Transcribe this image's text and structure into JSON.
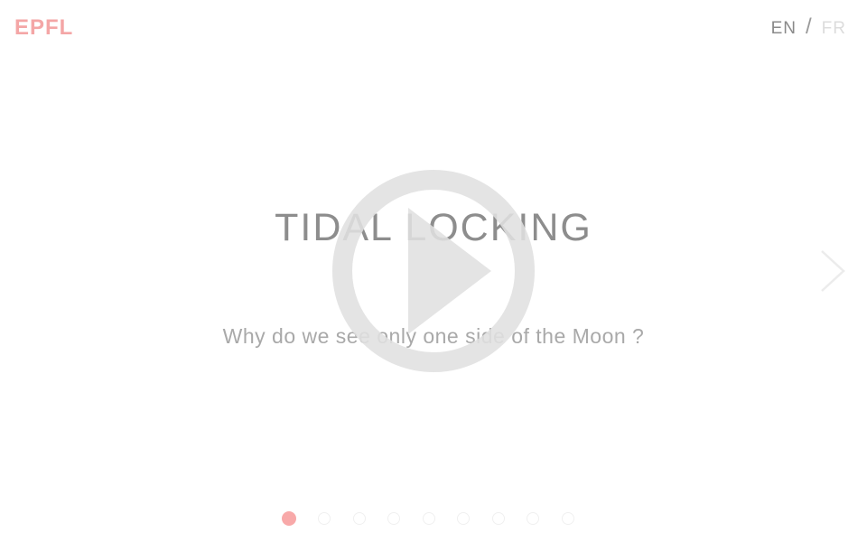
{
  "header": {
    "logo_text": "EPFL",
    "lang_en": "EN",
    "lang_separator": "/",
    "lang_fr": "FR"
  },
  "slide": {
    "title": "TIDAL LOCKING",
    "subtitle": "Why do we see only one side of the Moon ?"
  },
  "pagination": {
    "total": 9,
    "active_index": 0
  },
  "colors": {
    "brand": "#f4a6a6",
    "active_dot": "#f8a9a9",
    "play_icon": "#e3e3e3",
    "title_text": "#8d8d8d"
  },
  "icons": {
    "play": "play-icon",
    "next": "chevron-right-icon"
  }
}
